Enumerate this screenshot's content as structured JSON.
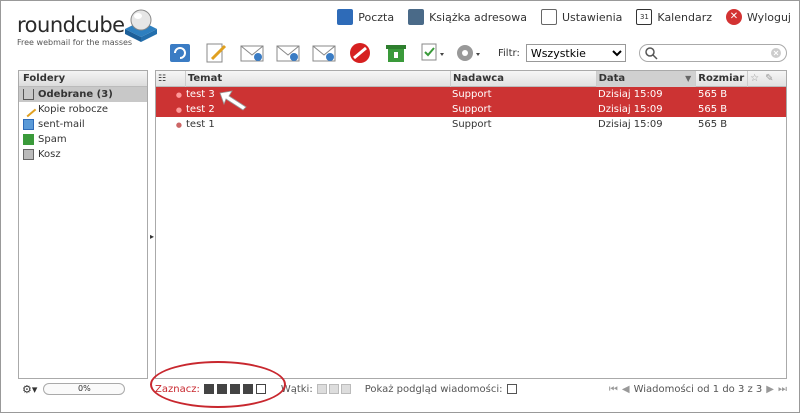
{
  "app": {
    "logo_name": "roundcube",
    "logo_tagline": "Free webmail for the masses"
  },
  "topnav": [
    {
      "label": "Poczta",
      "icon": "mail-icon",
      "color": "#2e6bb8"
    },
    {
      "label": "Książka adresowa",
      "icon": "addressbook-icon",
      "color": "#4a6a88"
    },
    {
      "label": "Ustawienia",
      "icon": "settings-icon",
      "color": "#666666"
    },
    {
      "label": "Kalendarz",
      "icon": "calendar-icon",
      "color": "#333333"
    },
    {
      "label": "Wyloguj",
      "icon": "logout-icon",
      "color": "#d33333"
    }
  ],
  "toolbar": [
    "refresh-icon",
    "compose-icon",
    "reply-icon",
    "reply-all-icon",
    "forward-icon",
    "delete-icon",
    "spam-icon",
    "mark-icon",
    "more-icon"
  ],
  "filter": {
    "label": "Filtr:",
    "selected": "Wszystkie",
    "search_placeholder": ""
  },
  "folders": {
    "title": "Foldery",
    "items": [
      {
        "label": "Odebrane (3)",
        "icon": "inbox-icon",
        "selected": true
      },
      {
        "label": "Kopie robocze",
        "icon": "drafts-icon",
        "selected": false
      },
      {
        "label": "sent-mail",
        "icon": "sent-icon",
        "selected": false
      },
      {
        "label": "Spam",
        "icon": "spam-folder-icon",
        "selected": false
      },
      {
        "label": "Kosz",
        "icon": "trash-icon",
        "selected": false
      }
    ],
    "quota": "0%"
  },
  "list": {
    "headers": {
      "subject": "Temat",
      "from": "Nadawca",
      "date": "Data",
      "size": "Rozmiar"
    },
    "rows": [
      {
        "subject": "test 3",
        "from": "Support",
        "date": "Dzisiaj 15:09",
        "size": "565 B",
        "selected": true
      },
      {
        "subject": "test 2",
        "from": "Support",
        "date": "Dzisiaj 15:09",
        "size": "565 B",
        "selected": true
      },
      {
        "subject": "test 1",
        "from": "Support",
        "date": "Dzisiaj 15:09",
        "size": "565 B",
        "selected": false
      }
    ]
  },
  "footer": {
    "select_label": "Zaznacz:",
    "threads_label": "Wątki:",
    "preview_label": "Pokaż podgląd wiadomości:",
    "pager_text": "Wiadomości od 1 do 3 z 3"
  },
  "colors": {
    "selection": "#cc3333",
    "annotation": "#c8272e"
  }
}
